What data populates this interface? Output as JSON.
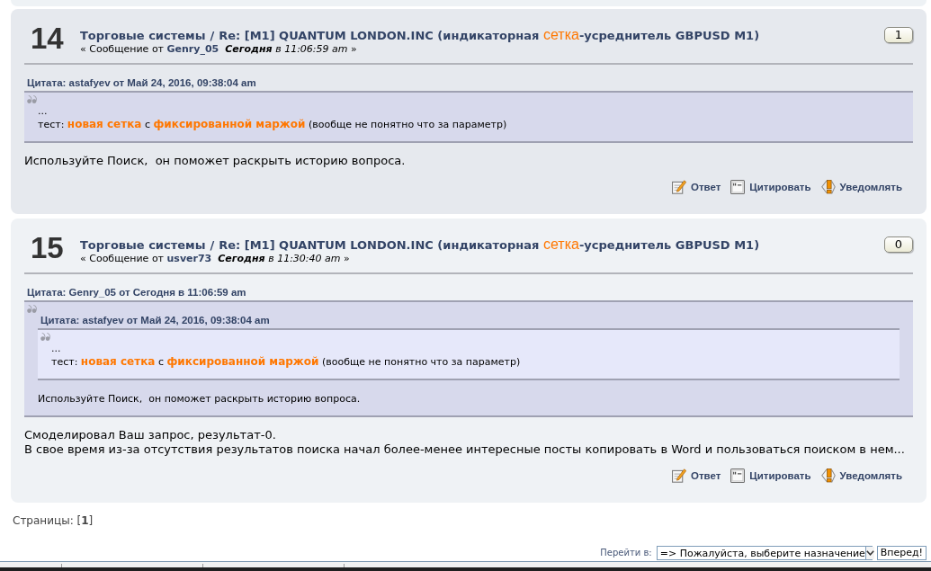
{
  "posts": [
    {
      "number": "14",
      "board": "Торговые системы",
      "separator": "/",
      "title": [
        {
          "text": "Re: [M1] QUANTUM LONDON.INC (индикаторная ",
          "highlight": false
        },
        {
          "text": "сетка",
          "highlight": true
        },
        {
          "text": "-усреднитель GBPUSD M1)",
          "highlight": false
        }
      ],
      "meta_prefix": "« Сообщение от",
      "author": "Genry_05",
      "date": "**Сегодня** в 11:06:59 am",
      "meta_suffix": "»",
      "karma": "1",
      "quote": {
        "header": "Цитата: astafyev от Май 24, 2016, 09:38:04 am",
        "content": [
          {
            "kind": "line",
            "segments": [
              {
                "text": "...",
                "highlight": false
              }
            ]
          },
          {
            "kind": "line",
            "segments": [
              {
                "text": "тест: ",
                "highlight": false
              },
              {
                "text": "новая сетка",
                "highlight": true
              },
              {
                "text": " с ",
                "highlight": false
              },
              {
                "text": "фиксированной маржой",
                "highlight": true
              },
              {
                "text": " (вообще не понятно что за параметр)",
                "highlight": false
              }
            ]
          }
        ]
      },
      "body": [
        "Используйте Поиск,  он поможет раскрыть историю вопроса."
      ],
      "actions": [
        {
          "kind": "reply",
          "label": "Ответ"
        },
        {
          "kind": "quote",
          "label": "Цитировать"
        },
        {
          "kind": "notify",
          "label": "Уведомлять"
        }
      ]
    },
    {
      "number": "15",
      "board": "Торговые системы",
      "separator": "/",
      "title": [
        {
          "text": "Re: [M1] QUANTUM LONDON.INC (индикаторная ",
          "highlight": false
        },
        {
          "text": "сетка",
          "highlight": true
        },
        {
          "text": "-усреднитель GBPUSD M1)",
          "highlight": false
        }
      ],
      "meta_prefix": "« Сообщение от",
      "author": "usver73",
      "date": "**Сегодня** в 11:30:40 am",
      "meta_suffix": "»",
      "karma": "0",
      "quote": {
        "header": "Цитата: Genry_05 от Сегодня в 11:06:59 am",
        "content": [
          {
            "kind": "quote",
            "header": "Цитата: astafyev от Май 24, 2016, 09:38:04 am",
            "content": [
              {
                "kind": "line",
                "segments": [
                  {
                    "text": "...",
                    "highlight": false
                  }
                ]
              },
              {
                "kind": "line",
                "segments": [
                  {
                    "text": "тест: ",
                    "highlight": false
                  },
                  {
                    "text": "новая сетка",
                    "highlight": true
                  },
                  {
                    "text": " с ",
                    "highlight": false
                  },
                  {
                    "text": "фиксированной маржой",
                    "highlight": true
                  },
                  {
                    "text": " (вообще не понятно что за параметр)",
                    "highlight": false
                  }
                ]
              }
            ]
          },
          {
            "kind": "line",
            "segments": [
              {
                "text": "Используйте Поиск,  он поможет раскрыть историю вопроса.",
                "highlight": false
              }
            ]
          }
        ]
      },
      "body": [
        "Смоделировал Ваш запрос, результат-0.",
        "В свое время из-за отсутствия результатов поиска начал более-менее интересные посты копировать в Word и пользоваться поиском в нем..."
      ],
      "actions": [
        {
          "kind": "reply",
          "label": "Ответ"
        },
        {
          "kind": "quote",
          "label": "Цитировать"
        },
        {
          "kind": "notify",
          "label": "Уведомлять"
        }
      ]
    }
  ],
  "pagination": "Страницы: [**1**]",
  "jump": {
    "label": "Перейти в:",
    "select": "=> Пожалуйста, выберите назначение",
    "button": "Вперед!"
  }
}
